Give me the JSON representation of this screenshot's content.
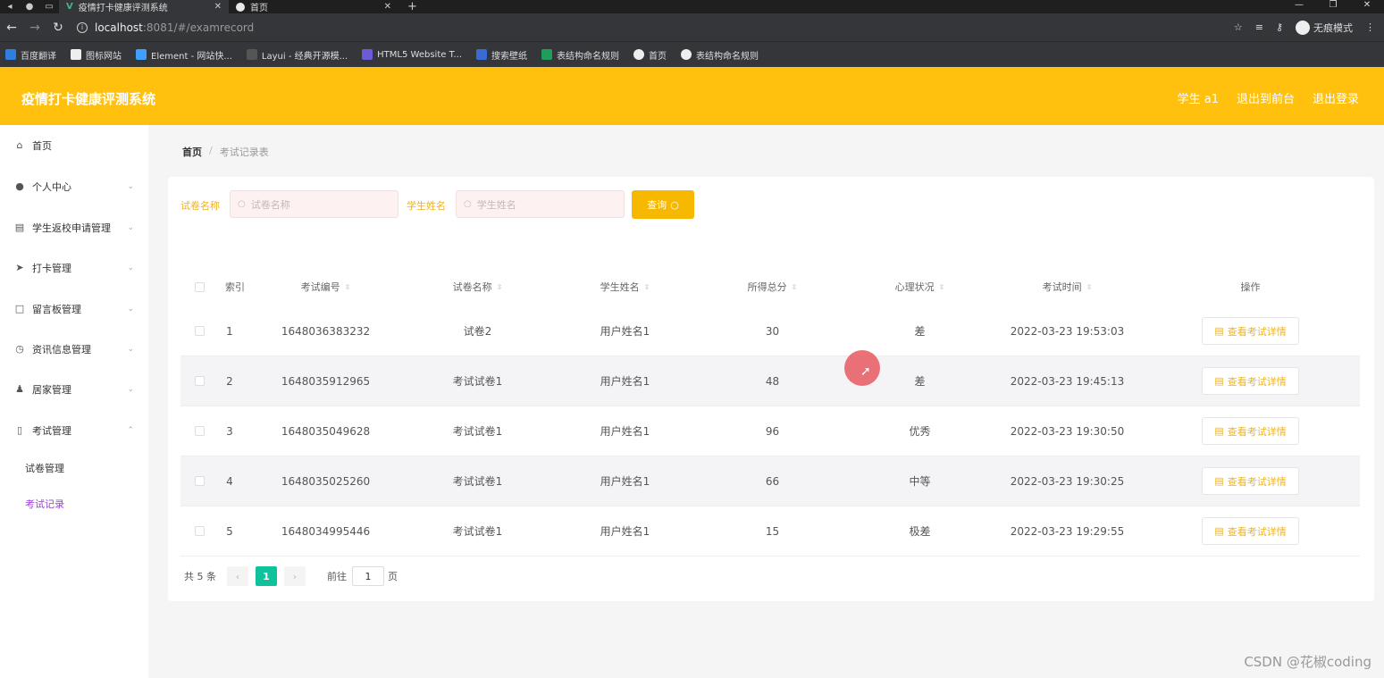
{
  "browser": {
    "tabs": [
      {
        "title": "疫情打卡健康评测系统",
        "active": true
      },
      {
        "title": "首页",
        "active": false
      }
    ],
    "url_host": "localhost",
    "url_path": ":8081/#/examrecord",
    "incognito_label": "无痕模式",
    "bookmarks": [
      "百度翻译",
      "图标网站",
      "Element - 网站快...",
      "Layui - 经典开源模...",
      "HTML5 Website T...",
      "搜索壁纸",
      "表结构命名规则",
      "首页",
      "表结构命名规则"
    ]
  },
  "header": {
    "title": "疫情打卡健康评测系统",
    "user": "学生 a1",
    "front_link": "退出到前台",
    "logout_link": "退出登录"
  },
  "sidebar": {
    "items": [
      {
        "label": "首页"
      },
      {
        "label": "个人中心"
      },
      {
        "label": "学生返校申请管理"
      },
      {
        "label": "打卡管理"
      },
      {
        "label": "留言板管理"
      },
      {
        "label": "资讯信息管理"
      },
      {
        "label": "居家管理"
      },
      {
        "label": "考试管理"
      }
    ],
    "sub_items": [
      {
        "label": "试卷管理",
        "active": false
      },
      {
        "label": "考试记录",
        "active": true
      }
    ]
  },
  "breadcrumb": {
    "home": "首页",
    "sep": "/",
    "current": "考试记录表"
  },
  "search": {
    "paper_label": "试卷名称",
    "paper_placeholder": "试卷名称",
    "student_label": "学生姓名",
    "student_placeholder": "学生姓名",
    "button": "查询"
  },
  "table": {
    "headers": {
      "index": "索引",
      "exam_no": "考试编号",
      "paper": "试卷名称",
      "student": "学生姓名",
      "score": "所得总分",
      "mental": "心理状况",
      "time": "考试时间",
      "action": "操作"
    },
    "action_label": "查看考试详情",
    "rows": [
      {
        "index": "1",
        "exam_no": "1648036383232",
        "paper": "试卷2",
        "student": "用户姓名1",
        "score": "30",
        "mental": "差",
        "time": "2022-03-23 19:53:03"
      },
      {
        "index": "2",
        "exam_no": "1648035912965",
        "paper": "考试试卷1",
        "student": "用户姓名1",
        "score": "48",
        "mental": "差",
        "time": "2022-03-23 19:45:13"
      },
      {
        "index": "3",
        "exam_no": "1648035049628",
        "paper": "考试试卷1",
        "student": "用户姓名1",
        "score": "96",
        "mental": "优秀",
        "time": "2022-03-23 19:30:50"
      },
      {
        "index": "4",
        "exam_no": "1648035025260",
        "paper": "考试试卷1",
        "student": "用户姓名1",
        "score": "66",
        "mental": "中等",
        "time": "2022-03-23 19:30:25"
      },
      {
        "index": "5",
        "exam_no": "1648034995446",
        "paper": "考试试卷1",
        "student": "用户姓名1",
        "score": "15",
        "mental": "极差",
        "time": "2022-03-23 19:29:55"
      }
    ]
  },
  "pagination": {
    "total": "共 5 条",
    "current": "1",
    "goto_prefix": "前往",
    "goto_value": "1",
    "goto_suffix": "页"
  },
  "watermark": "CSDN @花椒coding",
  "colors": {
    "header_bg": "#ffc10e",
    "accent": "#f6b800",
    "active_menu": "#9b41d6",
    "page_current": "#10c29b"
  }
}
